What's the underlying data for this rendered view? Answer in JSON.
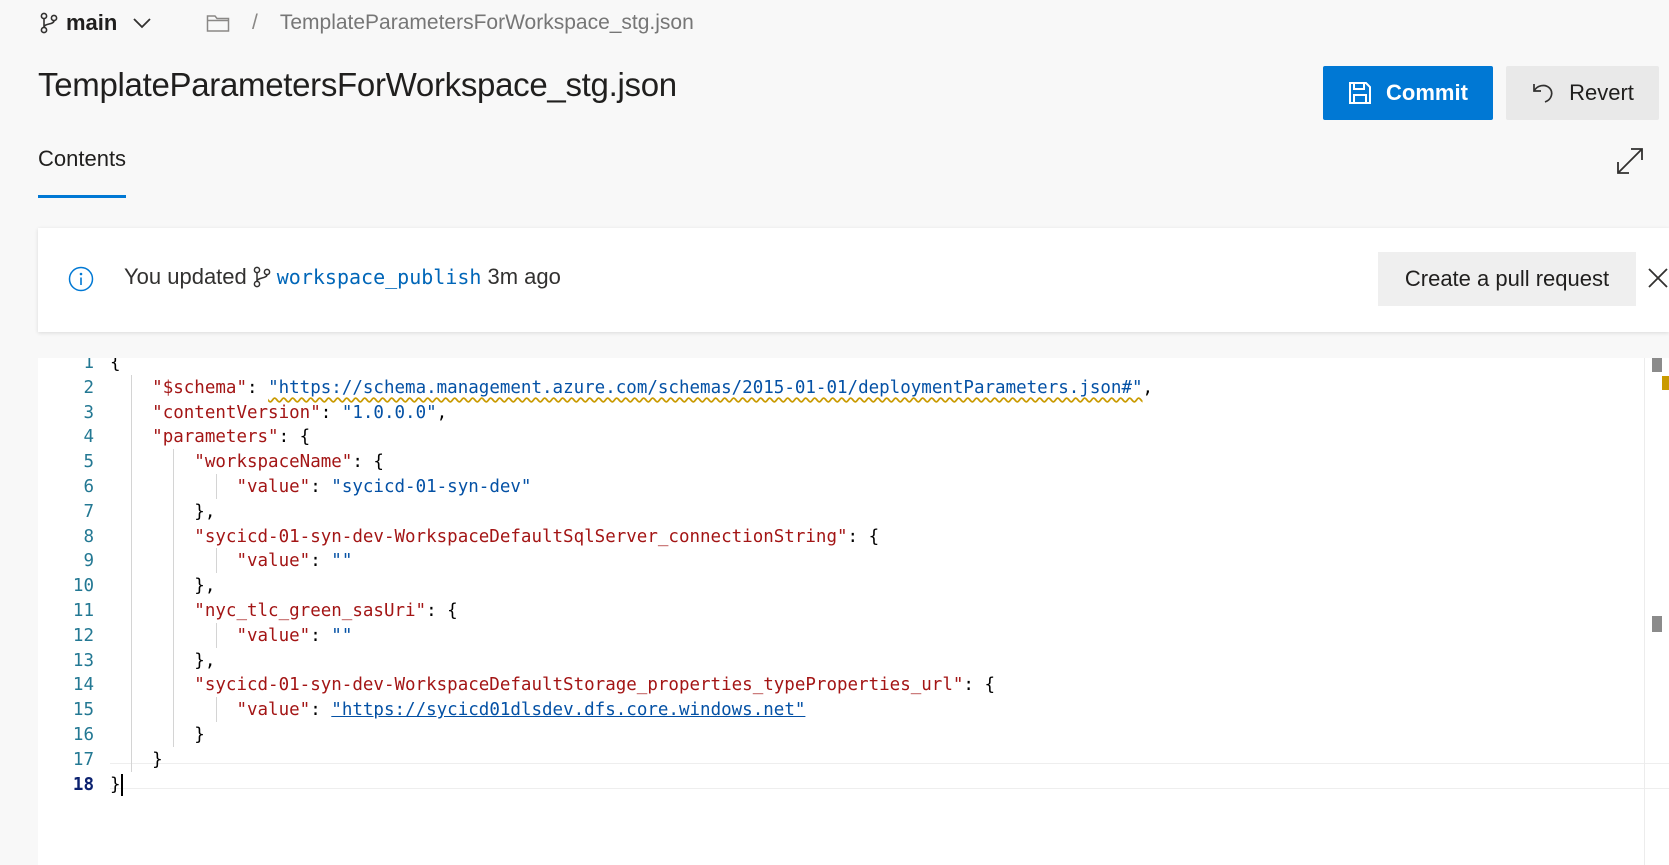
{
  "breadcrumb": {
    "branch": "main",
    "separator": "/",
    "file": "TemplateParametersForWorkspace_stg.json"
  },
  "header": {
    "title": "TemplateParametersForWorkspace_stg.json",
    "commit_label": "Commit",
    "revert_label": "Revert"
  },
  "tabs": [
    {
      "label": "Contents",
      "active": true
    }
  ],
  "notification": {
    "prefix": "You updated",
    "branch": "workspace_publish",
    "suffix": "3m ago",
    "action_label": "Create a pull request"
  },
  "editor": {
    "current_line": 18,
    "lines": [
      "{",
      "    \"$schema\": \"https://schema.management.azure.com/schemas/2015-01-01/deploymentParameters.json#\",",
      "    \"contentVersion\": \"1.0.0.0\",",
      "    \"parameters\": {",
      "        \"workspaceName\": {",
      "            \"value\": \"sycicd-01-syn-dev\"",
      "        },",
      "        \"sycicd-01-syn-dev-WorkspaceDefaultSqlServer_connectionString\": {",
      "            \"value\": \"\"",
      "        },",
      "        \"nyc_tlc_green_sasUri\": {",
      "            \"value\": \"\"",
      "        },",
      "        \"sycicd-01-syn-dev-WorkspaceDefaultStorage_properties_typeProperties_url\": {",
      "            \"value\": \"https://sycicd01dlsdev.dfs.core.windows.net\"",
      "        }",
      "    }",
      "}"
    ]
  },
  "colors": {
    "accent": "#0078d4",
    "json_key": "#a31515",
    "json_string": "#0451a5",
    "line_number": "#237893",
    "warning": "#c99a00"
  },
  "icons": {
    "branch": "branch-icon",
    "chevron": "chevron-down-icon",
    "folder": "folder-icon",
    "save": "save-icon",
    "revert": "undo-icon",
    "expand": "expand-icon",
    "info": "info-icon",
    "close": "close-icon"
  }
}
